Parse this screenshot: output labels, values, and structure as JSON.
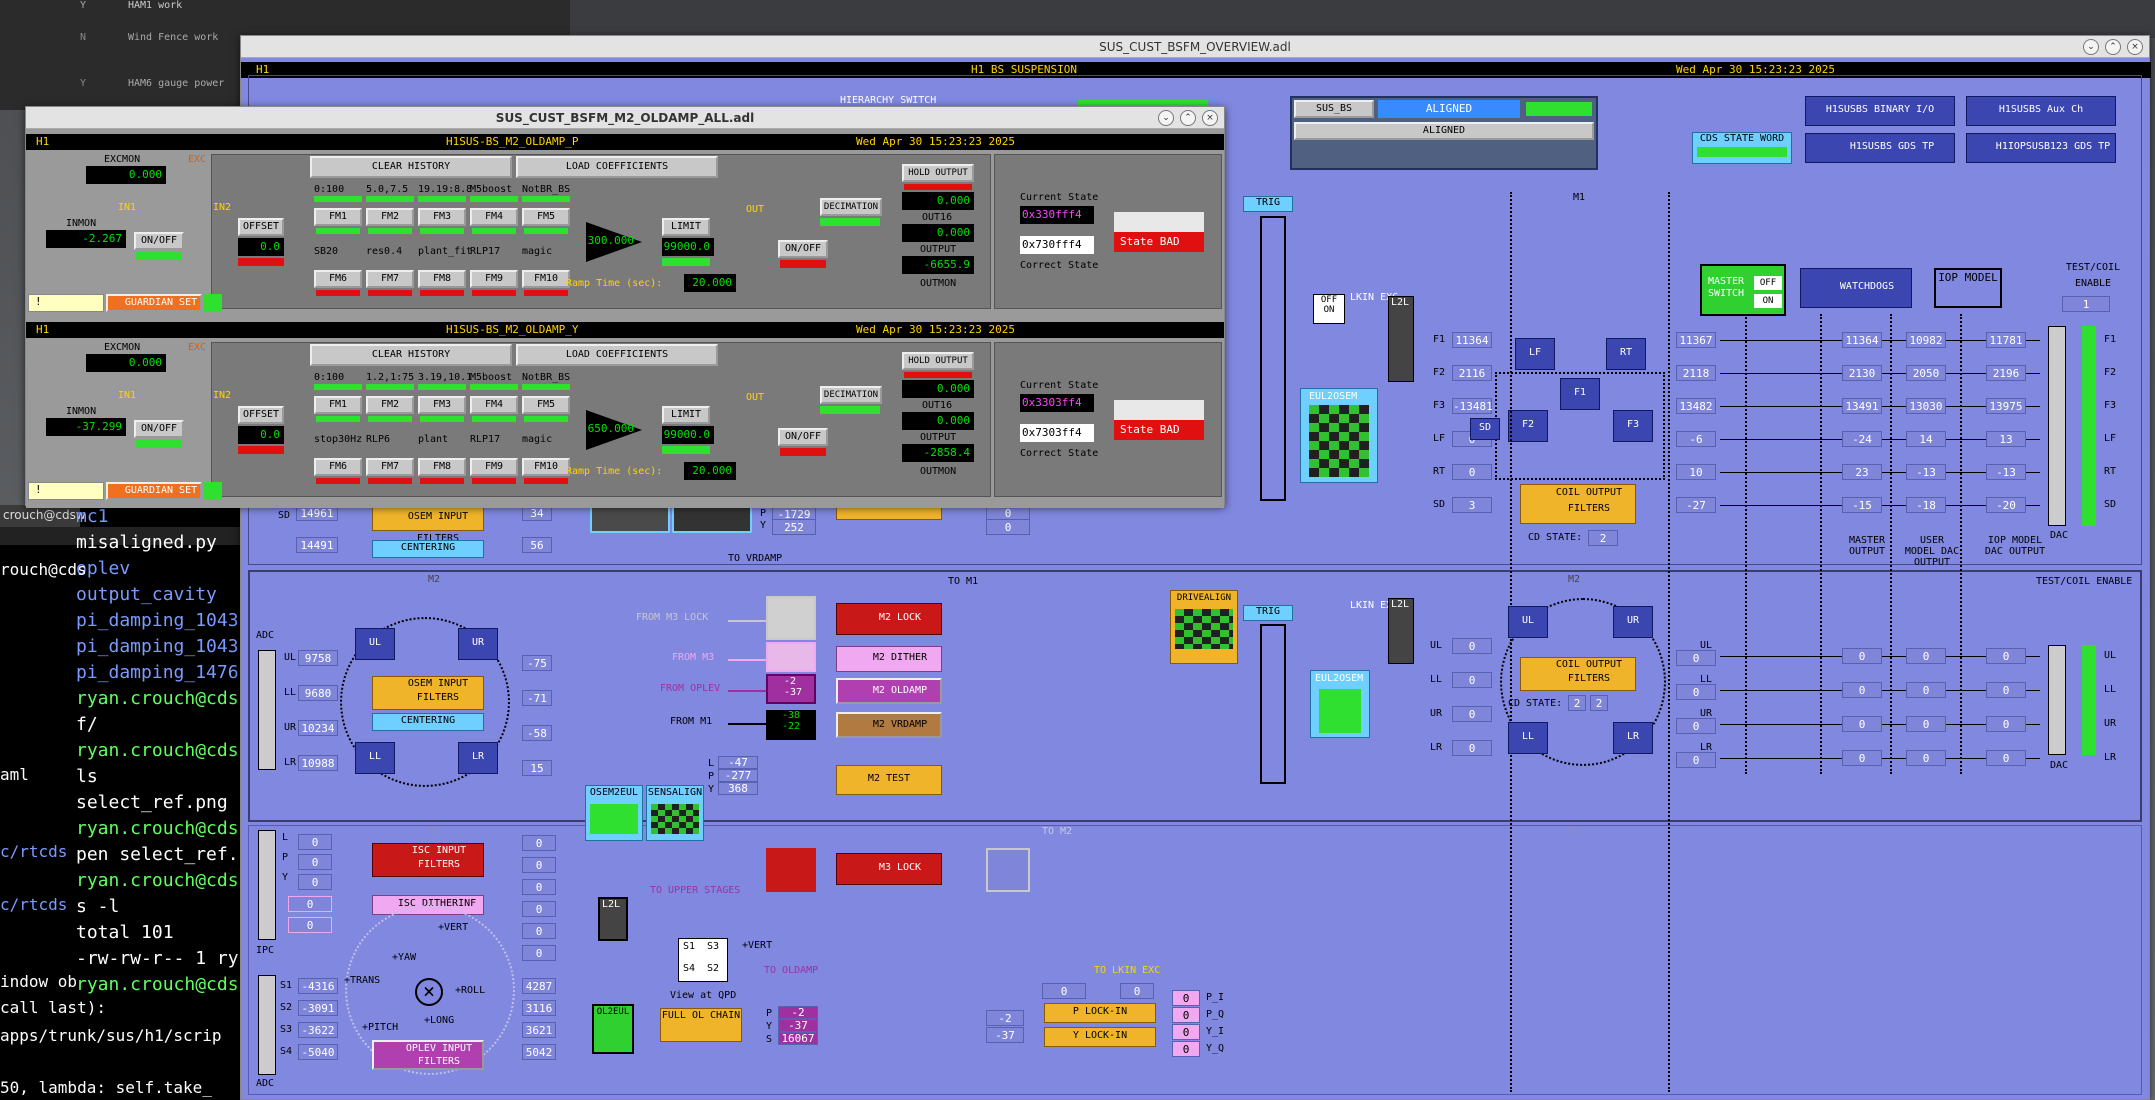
{
  "desktop": {
    "top_list": [
      {
        "code": "Y",
        "text": "HAM1 work"
      },
      {
        "code": "N",
        "text": "Wind Fence work"
      },
      {
        "code": "Y",
        "text": "HAM6 gauge power"
      }
    ],
    "terminal_lines": [
      "mc1",
      "misaligned.py",
      "oplev",
      "output_cavity",
      "pi_damping_1043",
      "pi_damping_1043",
      "pi_damping_1476",
      "ryan.crouch@cds",
      "f/",
      "ryan.crouch@cds",
      "ls",
      "select_ref.png",
      "ryan.crouch@cds",
      "pen select_ref.",
      "ryan.crouch@cds",
      "s -l",
      "total 101",
      "-rw-rw-r-- 1 ry",
      "ryan.crouch@cds"
    ],
    "terminal_left": [
      "rouch@cds",
      "aml",
      "c/rtcds",
      "c/rtcds",
      "indow ob",
      "call last):",
      "apps/trunk/sus/h1/scrip",
      "50, lambda: self.take_"
    ],
    "terminal_tab": "crouch@cdsw"
  },
  "overview": {
    "title": "SUS_CUST_BSFM_OVERVIEW.adl",
    "ifo": "H1",
    "system": "H1 BS SUSPENSION",
    "date": "Wed Apr 30 15:23:23 2025",
    "hierarchy": "HIERARCHY SWITCH",
    "sus_bs": "SUS_BS",
    "aligned": "ALIGNED",
    "aligned2": "ALIGNED",
    "cds_state_word": "CDS STATE WORD",
    "binary_io": "H1SUSBS BINARY I/O",
    "aux_ch": "H1SUSBS Aux Ch",
    "gds_tp": "H1SUSBS GDS TP",
    "iop_gds": "H1IOPSUSB123 GDS TP",
    "trig": "TRIG",
    "m1": "M1",
    "m2": "M2",
    "m3": "M3",
    "master_switch": "MASTER SWITCH",
    "off": "OFF",
    "on": "ON",
    "watchdogs": "WATCHDOGS",
    "iop_model": "IOP MODEL",
    "test_coil": "TEST/COIL ENABLE",
    "test_coil2": "TEST/COIL ENABLE",
    "dac": "DAC",
    "adc": "ADC",
    "ipc": "IPC",
    "master_output": "MASTER OUTPUT",
    "user_dac": "USER MODEL DAC OUTPUT",
    "iop_dac": "IOP MODEL DAC OUTPUT",
    "m1_rows": [
      {
        "l": "F1",
        "in": "11364",
        "ma": "11364",
        "us": "10982",
        "io": "11781",
        "mi": "11367"
      },
      {
        "l": "F2",
        "in": "2116",
        "ma": "2130",
        "us": "2050",
        "io": "2196",
        "mi": "2118"
      },
      {
        "l": "F3",
        "in": "-13481",
        "ma": "13491",
        "us": "13030",
        "io": "13975",
        "mi": "13482"
      },
      {
        "l": "LF",
        "in": "0",
        "ma": "-24",
        "us": "14",
        "io": "13",
        "mi": "-6"
      },
      {
        "l": "RT",
        "in": "0",
        "ma": "23",
        "us": "-13",
        "io": "-13",
        "mi": "10"
      },
      {
        "l": "SD",
        "in": "3",
        "ma": "-15",
        "us": "-18",
        "io": "-20",
        "mi": "-27"
      }
    ],
    "m2_rows": [
      {
        "l": "UL",
        "in": "0",
        "ma": "0",
        "us": "0",
        "io": "0",
        "mi": "0"
      },
      {
        "l": "LL",
        "in": "0",
        "ma": "0",
        "us": "0",
        "io": "0",
        "mi": "0"
      },
      {
        "l": "UR",
        "in": "0",
        "ma": "0",
        "us": "0",
        "io": "0",
        "mi": "0"
      },
      {
        "l": "LR",
        "in": "0",
        "ma": "0",
        "us": "0",
        "io": "0",
        "mi": "0"
      }
    ],
    "coil_output": "COIL OUTPUT FILTERS",
    "cd_state": "CD STATE:",
    "cd_val": "2",
    "eul2osem": "EUL2OSEM",
    "lkin": "LKIN EXC",
    "l2l": "L2L",
    "f1": "F1",
    "f2": "F2",
    "f3": "F3",
    "lf": "LF",
    "rt": "RT",
    "sd": "SD",
    "ul": "UL",
    "ur": "UR",
    "ll": "LL",
    "lr": "LR",
    "m2_adc": [
      {
        "l": "UL",
        "v": "9758"
      },
      {
        "l": "LL",
        "v": "9680"
      },
      {
        "l": "UR",
        "v": "10234"
      },
      {
        "l": "LR",
        "v": "10988"
      }
    ],
    "m2_side": [
      "-75",
      "-71",
      "-58",
      "15"
    ],
    "osem_input": "OSEM INPUT FILTERS",
    "centering": "CENTERING",
    "osem2eul": "OSEM2EUL",
    "sensalign": "SENSALIGN",
    "sens_vals": [
      {
        "l": "L",
        "v": "-47"
      },
      {
        "l": "P",
        "v": "-277"
      },
      {
        "l": "Y",
        "v": "368"
      }
    ],
    "from_m3_lock": "FROM M3 LOCK",
    "from_m3": "FROM M3",
    "from_oplev": "FROM OPLEV",
    "from_m1": "FROM M1",
    "m2_lock": "M2 LOCK",
    "m2_dither": "M2 DITHER",
    "m2_oldamp": "M2 OLDAMP",
    "m2_vrdamp": "M2 VRDAMP",
    "m2_test": "M2 TEST",
    "oldamp_vals": [
      "-2",
      "-37"
    ],
    "vrdamp_vals": [
      "-38",
      "-22"
    ],
    "to_m1": "TO M1",
    "drivealign": "DRIVEALIGN",
    "to_vrdamp": "TO VRDAMP",
    "m1_low": {
      "sd_a": "14961",
      "sd": "14491",
      "v1": "34",
      "v2": "56",
      "p": "-1729",
      "y": "252"
    },
    "m3_left": [
      {
        "l": "L",
        "v": "0"
      },
      {
        "l": "P",
        "v": "0"
      },
      {
        "l": "Y",
        "v": "0"
      }
    ],
    "isc_input": "ISC INPUT FILTERS",
    "isc_dither": "ISC DITHERINF",
    "m3_lock": "M3 LOCK",
    "to_m2": "TO M2",
    "to_upper": "TO UPPER STAGES",
    "view_qpd": "View at QPD",
    "vert": "+VERT",
    "to_oldamp": "TO OLDAMP",
    "qpd": [
      "S1",
      "S3",
      "S4",
      "S2"
    ],
    "m3_adc": [
      {
        "l": "S1",
        "v": "-4316"
      },
      {
        "l": "S2",
        "v": "-3091"
      },
      {
        "l": "S3",
        "v": "-3622"
      },
      {
        "l": "S4",
        "v": "-5040"
      }
    ],
    "m3_side": [
      "4287",
      "3116",
      "3621",
      "5042"
    ],
    "ol2eul": "OL2EUL",
    "full_ol": "FULL OL CHAIN",
    "ol_vals": [
      {
        "l": "P",
        "v": "-2"
      },
      {
        "l": "Y",
        "v": "-37"
      },
      {
        "l": "S",
        "v": "16067"
      }
    ],
    "oplev_input": "OPLEV INPUT FILTERS",
    "dof": [
      "+YAW",
      "+VERT",
      "+TRANS",
      "+ROLL",
      "+PITCH",
      "+LONG"
    ],
    "p_lockin": "P LOCK-IN",
    "y_lockin": "Y LOCK-IN",
    "to_lkin": "TO LKIN EXC",
    "lockin_vals": [
      {
        "l": "P_I",
        "v": "0"
      },
      {
        "l": "P_Q",
        "v": "0"
      },
      {
        "l": "Y_I",
        "v": "0"
      },
      {
        "l": "Y_Q",
        "v": "0"
      }
    ],
    "lockin_mid": [
      "-2",
      "-37"
    ]
  },
  "oldamp": {
    "title": "SUS_CUST_BSFM_M2_OLDAMP_ALL.adl",
    "panels": [
      {
        "ifo": "H1",
        "name": "H1SUS-BS_M2_OLDAMP_P",
        "date": "Wed Apr 30 15:23:23 2025",
        "excmon": "EXCMON",
        "excmon_v": "0.000",
        "inmon": "INMON",
        "inmon_v": "-2.267",
        "in1": "IN1",
        "in2": "IN2",
        "exc": "EXC",
        "onoff": "ON/OFF",
        "offset": "OFFSET",
        "offset_v": "0.0",
        "clear": "CLEAR HISTORY",
        "load": "LOAD COEFFICIENTS",
        "fn_top": [
          "0:100",
          "5.0,7.5",
          "19.19:8.8",
          "M5boost",
          "NotBR_BS"
        ],
        "fn_bot": [
          "SB20",
          "res0.4",
          "plant_fit",
          "RLP17",
          "magic"
        ],
        "fm": [
          "FM1",
          "FM2",
          "FM3",
          "FM4",
          "FM5",
          "FM6",
          "FM7",
          "FM8",
          "FM9",
          "FM10"
        ],
        "gain": "300.000",
        "limit": "LIMIT",
        "limit_v": "99000.0",
        "out": "OUT",
        "onoff2": "ON/OFF",
        "decimation": "DECIMATION",
        "hold": "HOLD OUTPUT",
        "out16_v": "0.000",
        "out16": "OUT16",
        "output_v": "0.000",
        "output": "OUTPUT",
        "outmon_v": "-6655.9",
        "outmon": "OUTMON",
        "ramp": "Ramp Time (sec):",
        "ramp_v": "20.000",
        "cur": "Current State",
        "cur_v": "0x330fff4",
        "cor_v": "0x730fff4",
        "cor": "Correct State",
        "state": "State BAD",
        "guard": "GUARDIAN SET",
        "bang": "!"
      },
      {
        "ifo": "H1",
        "name": "H1SUS-BS_M2_OLDAMP_Y",
        "date": "Wed Apr 30 15:23:23 2025",
        "excmon": "EXCMON",
        "excmon_v": "0.000",
        "inmon": "INMON",
        "inmon_v": "-37.299",
        "in1": "IN1",
        "in2": "IN2",
        "exc": "EXC",
        "onoff": "ON/OFF",
        "offset": "OFFSET",
        "offset_v": "0.0",
        "clear": "CLEAR HISTORY",
        "load": "LOAD COEFFICIENTS",
        "fn_top": [
          "0:100",
          "1.2,1:75",
          "3.19,10.1",
          "M5boost",
          "NotBR_BS"
        ],
        "fn_bot": [
          "stop30Hz",
          "RLP6",
          "plant",
          "RLP17",
          "magic"
        ],
        "fm": [
          "FM1",
          "FM2",
          "FM3",
          "FM4",
          "FM5",
          "FM6",
          "FM7",
          "FM8",
          "FM9",
          "FM10"
        ],
        "gain": "650.000",
        "limit": "LIMIT",
        "limit_v": "99000.0",
        "out": "OUT",
        "onoff2": "ON/OFF",
        "decimation": "DECIMATION",
        "hold": "HOLD OUTPUT",
        "out16_v": "0.000",
        "out16": "OUT16",
        "output_v": "0.000",
        "output": "OUTPUT",
        "outmon_v": "-2858.4",
        "outmon": "OUTMON",
        "ramp": "Ramp Time (sec):",
        "ramp_v": "20.000",
        "cur": "Current State",
        "cur_v": "0x3303ff4",
        "cor_v": "0x7303ff4",
        "cor": "Correct State",
        "state": "State BAD",
        "guard": "GUARDIAN SET",
        "bang": "!"
      }
    ]
  },
  "colors": {
    "screen_bg": "#8088e0",
    "panel_bg": "#7a7a7a",
    "green": "#30e030",
    "red": "#e01010",
    "yellow": "#ffd400"
  }
}
